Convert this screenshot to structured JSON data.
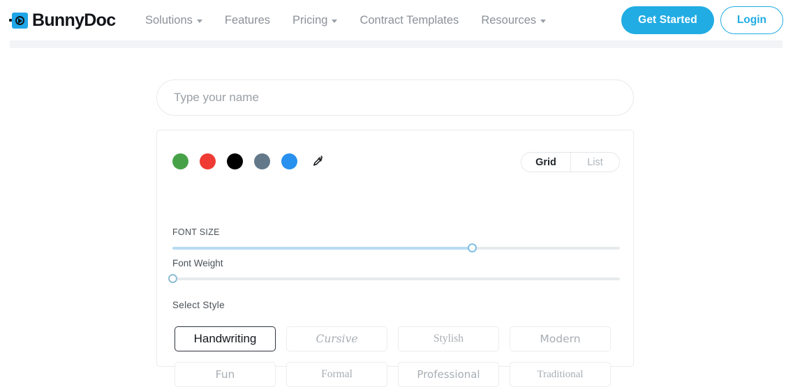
{
  "header": {
    "brand": "BunnyDoc",
    "nav": [
      {
        "label": "Solutions",
        "has_caret": true
      },
      {
        "label": "Features",
        "has_caret": false
      },
      {
        "label": "Pricing",
        "has_caret": true
      },
      {
        "label": "Contract Templates",
        "has_caret": false
      },
      {
        "label": "Resources",
        "has_caret": true
      }
    ],
    "get_started_label": "Get Started",
    "login_label": "Login",
    "accent_color": "#21ace3"
  },
  "signature_tool": {
    "name_input": {
      "placeholder": "Type your name",
      "value": ""
    },
    "colors": [
      {
        "name": "green",
        "hex": "#47a247"
      },
      {
        "name": "red",
        "hex": "#ef3b33"
      },
      {
        "name": "black",
        "hex": "#000000"
      },
      {
        "name": "slate",
        "hex": "#63798a"
      },
      {
        "name": "blue",
        "hex": "#2890ef"
      }
    ],
    "eyedropper_icon": "eyedropper-icon",
    "view_toggle": {
      "options": [
        "Grid",
        "List"
      ],
      "selected": "Grid"
    },
    "font_size": {
      "label": "FONT SIZE",
      "percent": 67
    },
    "font_weight": {
      "label": "Font Weight",
      "percent": 0
    },
    "select_style": {
      "label": "Select Style",
      "selected": "Handwriting",
      "options": [
        "Handwriting",
        "Cursive",
        "Stylish",
        "Modern",
        "Fun",
        "Formal",
        "Professional",
        "Traditional"
      ]
    }
  }
}
